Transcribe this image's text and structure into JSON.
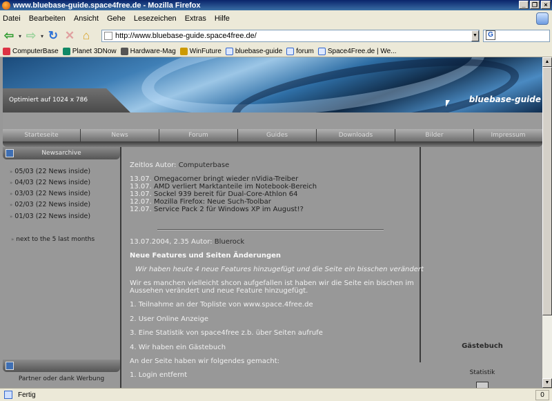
{
  "window": {
    "title": "www.bluebase-guide.space4free.de - Mozilla Firefox",
    "min": "_",
    "max": "❐",
    "close": "×"
  },
  "menu": [
    "Datei",
    "Bearbeiten",
    "Ansicht",
    "Gehe",
    "Lesezeichen",
    "Extras",
    "Hilfe"
  ],
  "nav": {
    "url": "http://www.bluebase-guide.space4free.de/",
    "search_icon": "G",
    "back_glyph": "⇦",
    "fwd_glyph": "⇨",
    "reload_glyph": "↻",
    "stop_glyph": "✕",
    "home_glyph": "⌂",
    "drop_glyph": "▾",
    "url_drop": "▼"
  },
  "bookmarks": [
    "ComputerBase",
    "Planet 3DNow",
    "Hardware-Mag",
    "WinFuture",
    "bluebase-guide",
    "forum",
    "Space4Free.de | We..."
  ],
  "banner": {
    "optimized": "Optimiert auf 1024 x 786",
    "brand": "bluebase-guide"
  },
  "site_nav": [
    "Starteseite",
    "News",
    "Forum",
    "Guides",
    "Downloads",
    "Bilder",
    "Impressum"
  ],
  "left": {
    "archive_title": "Newsarchive",
    "archive": [
      "05/03 (22 News inside)",
      "04/03 (22 News inside)",
      "03/03 (22 News inside)",
      "02/03 (22 News inside)",
      "01/03 (22 News inside)"
    ],
    "bullet": "»",
    "next_link": "next to the 5 last months",
    "partner": "Partner oder dank Werbung"
  },
  "center": {
    "zeitlos": "Zeitlos Autor:",
    "zeitlos_author": "Computerbase",
    "news": [
      {
        "date": "13.07.",
        "text": "Omegacorner bringt wieder nVidia-Treiber"
      },
      {
        "date": "13.07.",
        "text": "AMD verliert Marktanteile im Notebook-Bereich"
      },
      {
        "date": "13.07.",
        "text": "Sockel 939 bereit für Dual-Core-Athlon 64"
      },
      {
        "date": "12.07.",
        "text": "Mozilla Firefox: Neue Such-Toolbar"
      },
      {
        "date": "12.07.",
        "text": "Service Pack 2 für Windows XP im August!?"
      }
    ],
    "post_meta": "13.07.2004, 2.35 Autor:",
    "post_author": "Bluerock",
    "post_title": "Neue Features und Seiten Änderungen",
    "post_intro": "Wir haben heute 4 neue Features hinzugefügt und die Seite ein bisschen verändert",
    "post_p1a": "Wir es manchen vielleicht shcon aufgefallen ist haben wir die Seite ein bischen im",
    "post_p1b": "Aussehen verändert und neue Feature hinzugefügt.",
    "items": [
      "1. Teilnahme an der Topliste von www.space.4free.de",
      "2. User Online Anzeige",
      "3. Eine Statistik von space4free z.b. über Seiten aufrufe",
      "4. Wir haben ein Gästebuch"
    ],
    "changes": "An der Seite haben wir folgendes gemacht:",
    "change1": "1. Login entfernt"
  },
  "right": {
    "guestbook": "Gästebuch",
    "statistik": "Statistik"
  },
  "status": {
    "text": "Fertig",
    "count": "0"
  },
  "scroll": {
    "up": "▲",
    "down": "▼"
  }
}
